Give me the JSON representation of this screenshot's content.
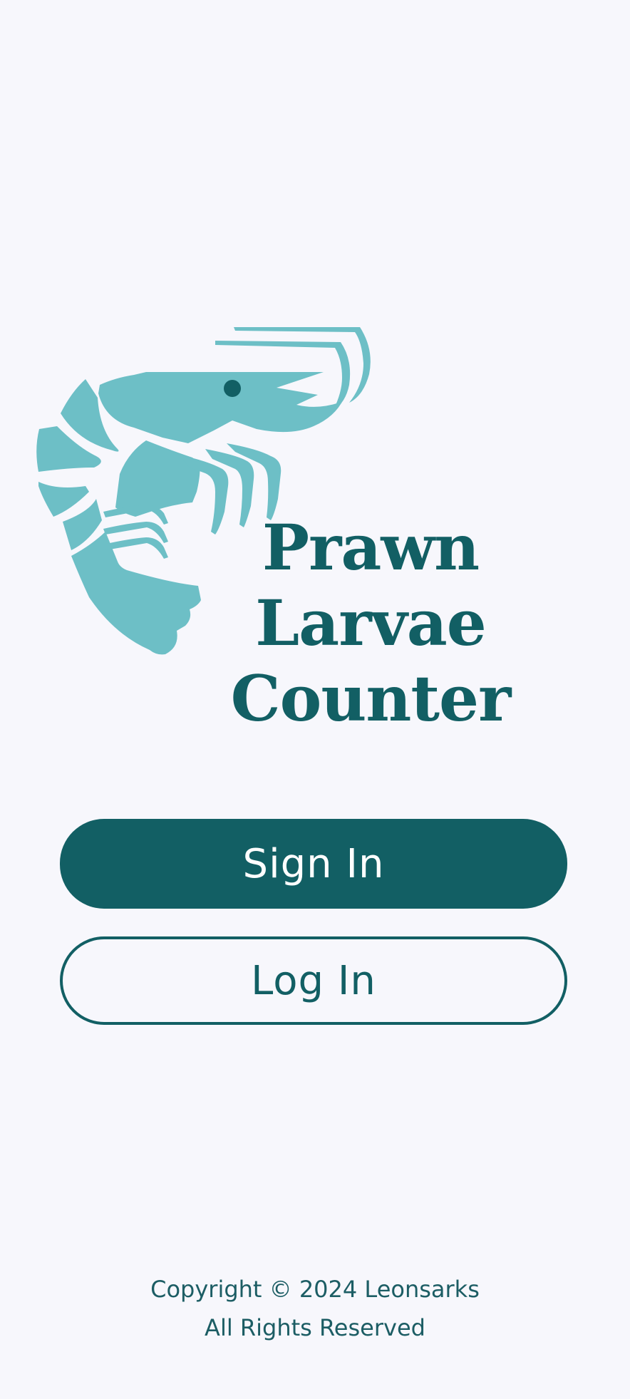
{
  "colors": {
    "background": "#f7f7fc",
    "primary": "#125f64",
    "logo_shrimp": "#6dbfc6"
  },
  "logo": {
    "icon": "shrimp-icon",
    "title_line1": "Prawn Larvae",
    "title_line2": "Counter"
  },
  "actions": {
    "sign_in_label": "Sign In",
    "log_in_label": "Log In"
  },
  "footer": {
    "copyright": "Copyright © 2024 Leonsarks",
    "rights": "All Rights Reserved"
  }
}
